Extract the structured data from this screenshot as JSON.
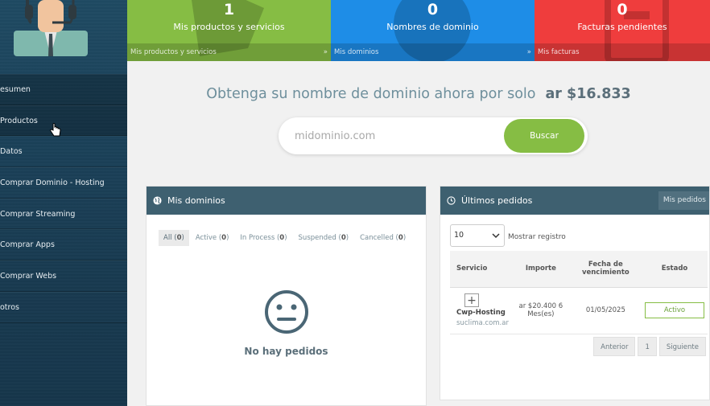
{
  "sidebar": {
    "items": [
      {
        "label": "esumen"
      },
      {
        "label": "Productos"
      },
      {
        "label": "Datos"
      },
      {
        "label": "Comprar Dominio - Hosting"
      },
      {
        "label": "Comprar Streaming"
      },
      {
        "label": "Comprar Apps"
      },
      {
        "label": "Comprar Webs"
      },
      {
        "label": "otros"
      }
    ]
  },
  "tiles": {
    "products": {
      "count": "1",
      "label": "Mis productos y servicios",
      "footer": "Mis productos y servicios",
      "arrow": "»"
    },
    "domains": {
      "count": "0",
      "label": "Nombres de dominio",
      "footer": "Mis dominios",
      "arrow": "»"
    },
    "invoices": {
      "count": "0",
      "label": "Facturas pendientes",
      "footer": "Mis facturas"
    }
  },
  "promo": {
    "text": "Obtenga su nombre de dominio ahora por solo",
    "price": "ar $16.833"
  },
  "search": {
    "placeholder": "midominio.com",
    "button": "Buscar"
  },
  "domains_panel": {
    "title": "Mis dominios",
    "filters": [
      {
        "label": "All",
        "count": "0"
      },
      {
        "label": "Active",
        "count": "0"
      },
      {
        "label": "In Process",
        "count": "0"
      },
      {
        "label": "Suspended",
        "count": "0"
      },
      {
        "label": "Cancelled",
        "count": "0"
      }
    ],
    "empty_text": "No hay pedidos"
  },
  "orders_panel": {
    "title": "Últimos pedidos",
    "button": "Mis pedidos",
    "per_page": "10",
    "show_label": "Mostrar registro",
    "columns": {
      "service": "Servicio",
      "amount": "Importe",
      "due": "Fecha de vencimiento",
      "status": "Estado"
    },
    "rows": [
      {
        "service": "Cwp-Hosting",
        "domain": "suclima.com.ar",
        "amount": "ar $20.400 6 Mes(es)",
        "due": "01/05/2025",
        "status": "Activo"
      }
    ],
    "pager": {
      "prev": "Anterior",
      "page": "1",
      "next": "Siguiente"
    }
  },
  "colors": {
    "green": "#86bd44",
    "blue": "#1e8de7",
    "red": "#ef3d3d",
    "panel_header": "#3e6070",
    "sidebar": "#1b4159"
  }
}
